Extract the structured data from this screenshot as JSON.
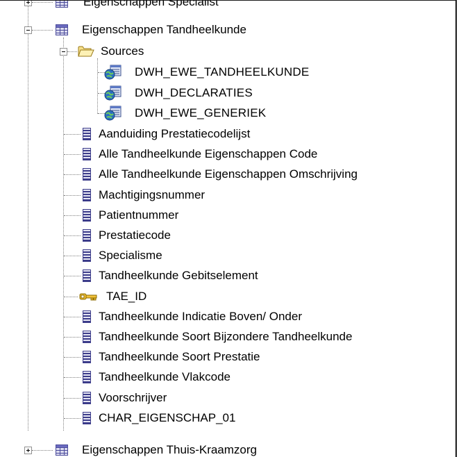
{
  "tree": {
    "partial_top_label": "Eigenschappen Specialist",
    "parent_label": "Eigenschappen Tandheelkunde",
    "sources_folder_label": "Sources",
    "sources": [
      "DWH_EWE_TANDHEELKUNDE",
      "DWH_DECLARATIES",
      "DWH_EWE_GENERIEK"
    ],
    "attributes": [
      "Aanduiding Prestatiecodelijst",
      "Alle Tandheelkunde Eigenschappen Code",
      "Alle Tandheelkunde Eigenschappen Omschrijving",
      "Machtigingsnummer",
      "Patientnummer",
      "Prestatiecode",
      "Specialisme",
      "Tandheelkunde Gebitselement",
      "TAE_ID",
      "Tandheelkunde Indicatie Boven/ Onder",
      "Tandheelkunde Soort Bijzondere Tandheelkunde",
      "Tandheelkunde Soort Prestatie",
      "Tandheelkunde Vlakcode",
      "Voorschrijver",
      "CHAR_EIGENSCHAP_01"
    ],
    "next_label": "Eigenschappen Thuis-Kraamzorg"
  },
  "icons": {
    "table": "table-icon",
    "folder": "folder-open-icon",
    "source": "data-source-icon",
    "attribute": "attribute-icon",
    "key": "key-icon"
  }
}
